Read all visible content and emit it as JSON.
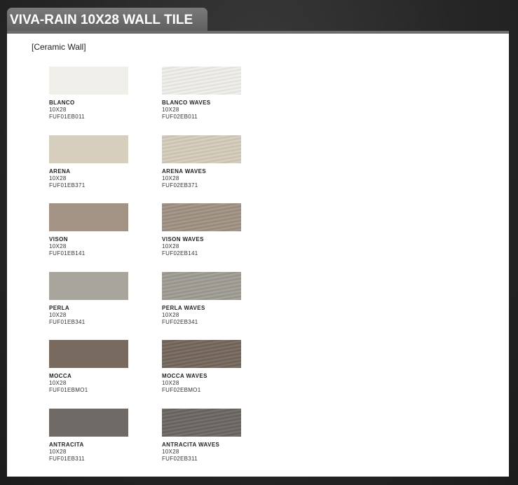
{
  "header": {
    "title": "VIVA-RAIN 10X28 WALL TILE"
  },
  "category_label": "[Ceramic Wall]",
  "tiles": [
    {
      "name": "BLANCO",
      "size": "10X28",
      "code": "FUF01EB011",
      "color": "#f1efea",
      "waves": false
    },
    {
      "name": "BLANCO WAVES",
      "size": "10X28",
      "code": "FUF02EB011",
      "color": "#f0eeea",
      "waves": true
    },
    {
      "name": "ARENA",
      "size": "10X28",
      "code": "FUF01EB371",
      "color": "#d6cfbe",
      "waves": false
    },
    {
      "name": "ARENA WAVES",
      "size": "10X28",
      "code": "FUF02EB371",
      "color": "#d4ccba",
      "waves": true
    },
    {
      "name": "VISON",
      "size": "10X28",
      "code": "FUF01EB141",
      "color": "#a29385",
      "waves": false
    },
    {
      "name": "VISON WAVES",
      "size": "10X28",
      "code": "FUF02EB141",
      "color": "#a09182",
      "waves": true
    },
    {
      "name": "PERLA",
      "size": "10X28",
      "code": "FUF01EB341",
      "color": "#a7a59c",
      "waves": false
    },
    {
      "name": "PERLA WAVES",
      "size": "10X28",
      "code": "FUF02EB341",
      "color": "#9e9c92",
      "waves": true
    },
    {
      "name": "MOCCA",
      "size": "10X28",
      "code": "FUF01EBMO1",
      "color": "#786a5f",
      "waves": false
    },
    {
      "name": "MOCCA WAVES",
      "size": "10X28",
      "code": "FUF02EBMO1",
      "color": "#74665b",
      "waves": true
    },
    {
      "name": "ANTRACITA",
      "size": "10X28",
      "code": "FUF01EB311",
      "color": "#6f6a66",
      "waves": false
    },
    {
      "name": "ANTRACITA WAVES",
      "size": "10X28",
      "code": "FUF02EB311",
      "color": "#6b6661",
      "waves": true
    }
  ]
}
